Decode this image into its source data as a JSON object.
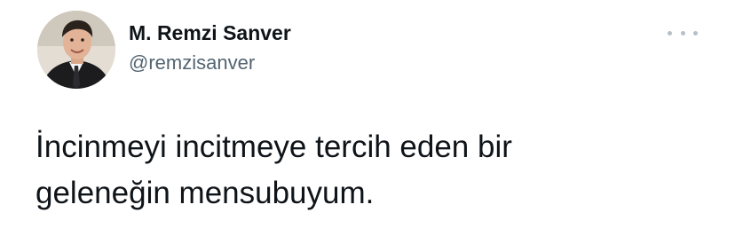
{
  "tweet": {
    "author": {
      "display_name": "M. Remzi Sanver",
      "handle": "@remzisanver",
      "avatar_icon": "profile-photo"
    },
    "more_icon": "more-horizontal-icon",
    "text_lines": [
      "İncinmeyi incitmeye tercih eden bir",
      "geleneğin mensubuyum."
    ]
  },
  "colors": {
    "name": "#0f1419",
    "handle": "#536471",
    "more_dots": "#b8bfc6"
  }
}
